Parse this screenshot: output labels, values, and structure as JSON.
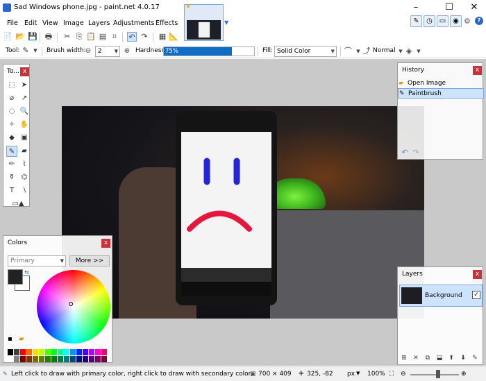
{
  "window": {
    "title": "Sad Windows phone.jpg - paint.net 4.0.17",
    "controls": [
      "–",
      "☐",
      "✕"
    ]
  },
  "menu": [
    "File",
    "Edit",
    "View",
    "Image",
    "Layers",
    "Adjustments",
    "Effects"
  ],
  "toolbar": {
    "tool_label": "Tool:",
    "brush_width_label": "Brush width:",
    "brush_width_value": "2",
    "hardness_label": "Hardness:",
    "hardness_value": "75%",
    "hardness_percent": 75,
    "fill_label": "Fill:",
    "fill_value": "Solid Color",
    "blend_value": "Normal"
  },
  "tools_panel": {
    "title": "To..."
  },
  "history_panel": {
    "title": "History",
    "items": [
      {
        "label": "Open Image",
        "selected": false
      },
      {
        "label": "Paintbrush",
        "selected": true
      }
    ]
  },
  "colors_panel": {
    "title": "Colors",
    "mode": "Primary",
    "more_button": "More >>",
    "primary_color": "#222222",
    "secondary_color": "#ffffff",
    "palette": [
      "#000000",
      "#404040",
      "#ff0000",
      "#ff6a00",
      "#ffd800",
      "#b6ff00",
      "#4cff00",
      "#00ff21",
      "#00ff90",
      "#00ffff",
      "#0094ff",
      "#0026ff",
      "#4800ff",
      "#b200ff",
      "#ff00dc",
      "#ff006e",
      "#ffffff",
      "#808080",
      "#7f0000",
      "#7f3300",
      "#7f6a00",
      "#5b7f00",
      "#267f00",
      "#007f0e",
      "#007f46",
      "#007f7f",
      "#004a7f",
      "#00137f",
      "#21007f",
      "#57007f",
      "#7f006e",
      "#7f0037"
    ]
  },
  "layers_panel": {
    "title": "Layers",
    "layers": [
      {
        "name": "Background",
        "visible": true
      }
    ]
  },
  "statusbar": {
    "hint": "Left click to draw with primary color, right click to draw with secondary color.",
    "image_size": "700 × 409",
    "cursor_pos": "325, -82",
    "units": "px",
    "zoom": "100%"
  },
  "colors": {
    "accent": "#0f6dc6",
    "selection": "#cde3fb",
    "close_red": "#c8333a",
    "workspace": "#c9c9c9"
  }
}
